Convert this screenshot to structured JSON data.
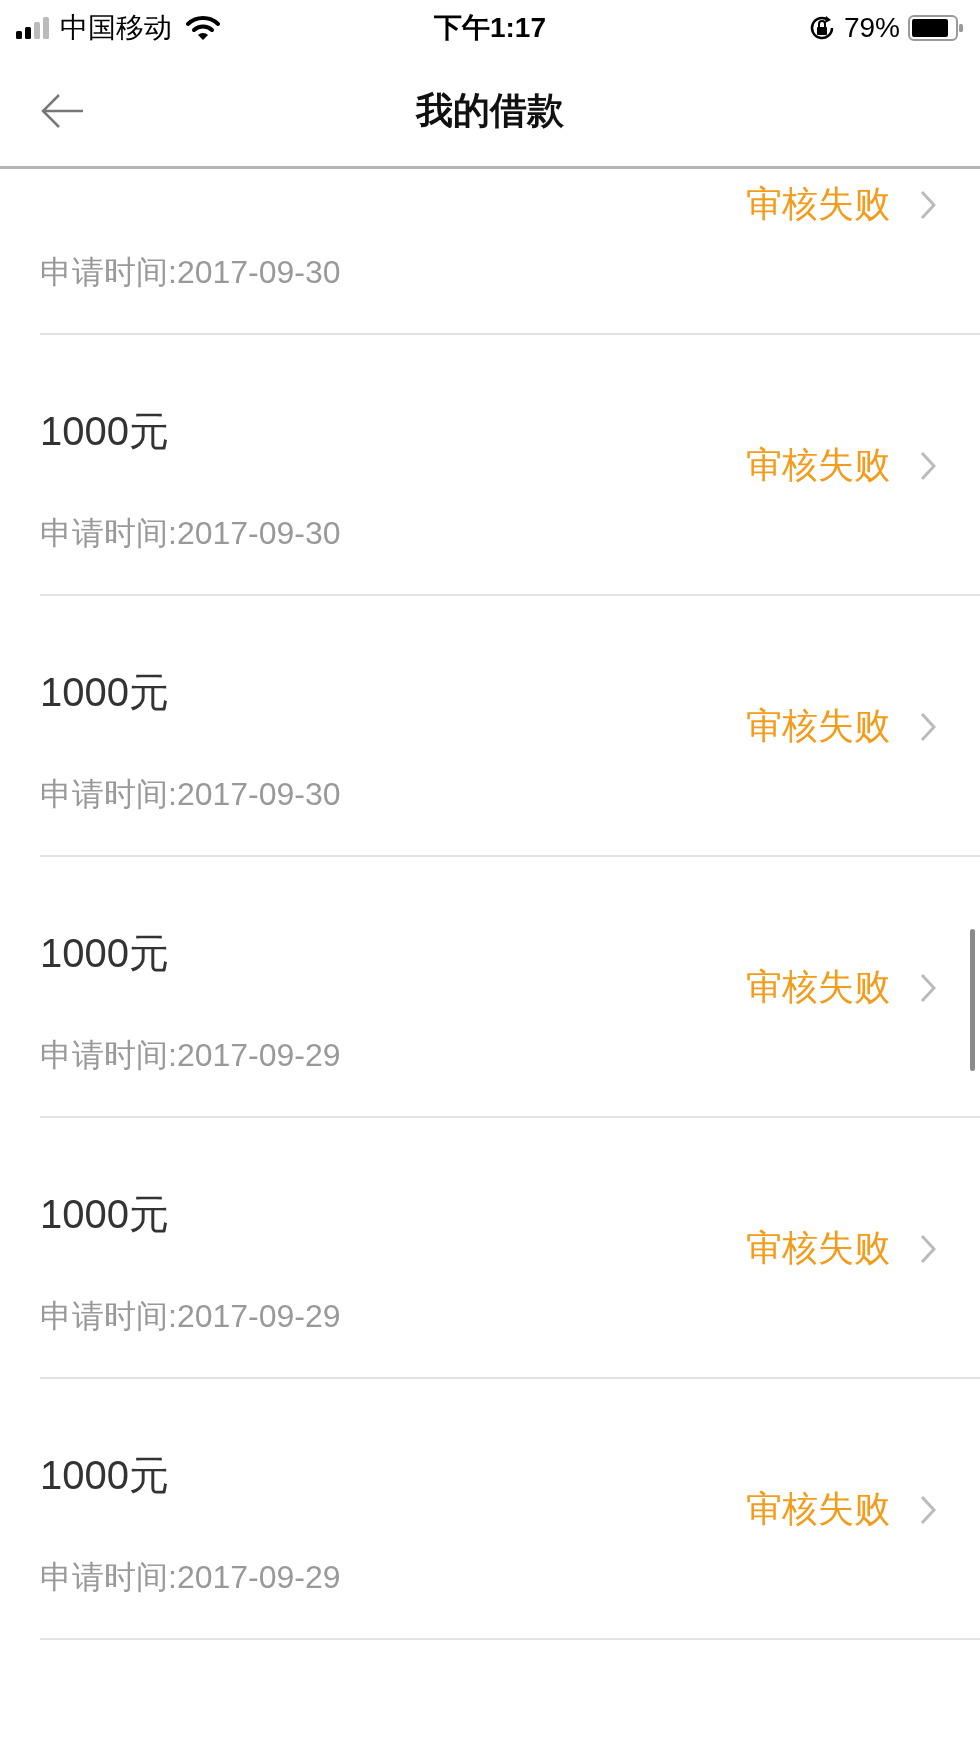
{
  "status_bar": {
    "carrier": "中国移动",
    "time": "下午1:17",
    "battery": "79%"
  },
  "nav": {
    "title": "我的借款"
  },
  "loans": [
    {
      "status": "审核失败",
      "date": "申请时间:2017-09-30"
    },
    {
      "amount": "1000元",
      "status": "审核失败",
      "date": "申请时间:2017-09-30"
    },
    {
      "amount": "1000元",
      "status": "审核失败",
      "date": "申请时间:2017-09-30"
    },
    {
      "amount": "1000元",
      "status": "审核失败",
      "date": "申请时间:2017-09-29"
    },
    {
      "amount": "1000元",
      "status": "审核失败",
      "date": "申请时间:2017-09-29"
    },
    {
      "amount": "1000元",
      "status": "审核失败",
      "date": "申请时间:2017-09-29"
    }
  ]
}
